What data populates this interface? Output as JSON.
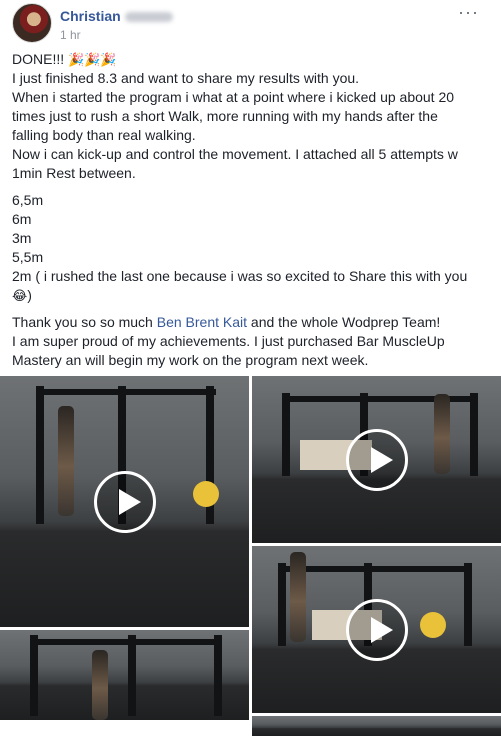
{
  "post": {
    "author": "Christian",
    "time": "1 hr",
    "more_icon": "ellipsis-icon",
    "paragraphs": [
      {
        "lines": [
          [
            "DONE!!! ",
            "🎉🎉🎉"
          ],
          [
            "I just finished 8.3 and want to share my results with you."
          ],
          [
            "When i started the program i what at a point where i kicked up about 20"
          ],
          [
            "times just to rush a short Walk, more running with my hands after the"
          ],
          [
            "falling body than real walking."
          ],
          [
            "Now i can kick-up and control the movement. I attached all 5 attempts w"
          ],
          [
            "1min Rest between."
          ]
        ]
      },
      {
        "lines": [
          [
            "6,5m"
          ],
          [
            "6m"
          ],
          [
            "3m"
          ],
          [
            "5,5m"
          ],
          [
            "2m ( i rushed the last one because i was so excited to Share this with you"
          ],
          [
            "😂",
            ")"
          ]
        ]
      }
    ],
    "thanks": {
      "line1_before": "Thank you so so much ",
      "tag": "Ben Brent Kait",
      "line1_after": " and the whole Wodprep Team!",
      "line2": "I am super proud of my achievements. I just purchased Bar MuscleUp",
      "line3": "Mastery an will begin my work on the program next week."
    }
  },
  "colors": {
    "link": "#365899",
    "text": "#1d2129",
    "meta": "#90949c"
  },
  "media": {
    "play_icon": "play-icon",
    "videos": [
      "video-1",
      "video-2",
      "video-3",
      "video-4",
      "video-5"
    ]
  }
}
